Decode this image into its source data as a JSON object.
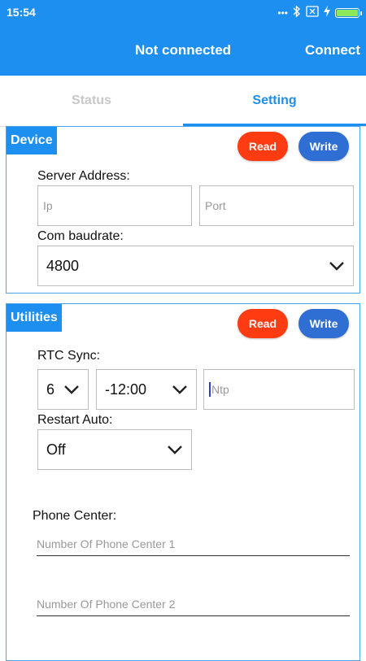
{
  "status_bar": {
    "time": "15:54",
    "icons": [
      "dots-icon",
      "bluetooth-icon",
      "sim-x-icon",
      "charging-icon",
      "battery-icon"
    ],
    "battery_color": "#8ee65a",
    "battery_level": 1.0
  },
  "app_bar": {
    "title": "Not connected",
    "action": "Connect",
    "color": "#1c8ff0"
  },
  "tabs": [
    {
      "label": "Status",
      "selected": false
    },
    {
      "label": "Setting",
      "selected": true
    }
  ],
  "device": {
    "section_label": "Device",
    "read_label": "Read",
    "write_label": "Write",
    "server_address_label": "Server Address:",
    "ip_placeholder": "Ip",
    "port_placeholder": "Port",
    "baud_label": "Com baudrate:",
    "baud_value": "4800"
  },
  "utilities": {
    "section_label": "Utilities",
    "read_label": "Read",
    "write_label": "Write",
    "rtc_label": "RTC Sync:",
    "rtc_value": "6",
    "timezone_value": "-12:00",
    "ntp_placeholder": "Ntp",
    "restart_label": "Restart Auto:",
    "restart_value": "Off",
    "phone_center_label": "Phone Center:",
    "phone_center_1_placeholder": "Number Of Phone Center 1",
    "phone_center_2_placeholder": "Number Of Phone Center 2"
  },
  "colors": {
    "read_button": "#ff3b12",
    "write_button": "#2f6fd4",
    "accent": "#1c8ff0"
  }
}
